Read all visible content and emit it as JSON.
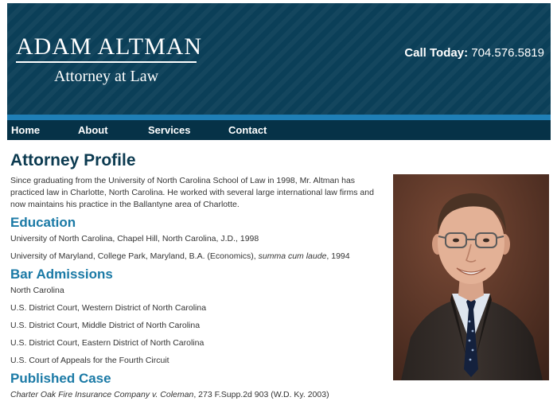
{
  "header": {
    "logo_name": "ADAM ALTMAN",
    "logo_sub": "Attorney at Law",
    "phone_label": "Call Today:",
    "phone_number": "704.576.5819"
  },
  "nav": {
    "items": [
      "Home",
      "About",
      "Services",
      "Contact"
    ]
  },
  "profile": {
    "title": "Attorney Profile",
    "intro": "Since graduating from the University of North Carolina School of Law in 1998, Mr. Altman has practiced law in Charlotte, North Carolina. He worked with several large international law firms and now maintains his practice in the Ballantyne area of Charlotte."
  },
  "education": {
    "heading": "Education",
    "item1": "University of North Carolina, Chapel Hill, North Carolina, J.D., 1998",
    "item2_text": "University of Maryland, College Park, Maryland, B.A. (Economics),",
    "item2_honor": "summa cum laude",
    "item2_year": ", 1994"
  },
  "bar": {
    "heading": "Bar Admissions",
    "items": [
      "North Carolina",
      "U.S. District Court, Western District of North Carolina",
      "U.S. District Court, Middle District of North Carolina",
      "U.S. District Court, Eastern District of North Carolina",
      "U.S. Court of Appeals for the Fourth Circuit"
    ]
  },
  "published": {
    "heading": "Published Case",
    "case_name": "Charter Oak Fire Insurance Company v. Coleman",
    "citation": ", 273 F.Supp.2d 903 (W.D. Ky. 2003)"
  },
  "colors": {
    "header_bg": "#0b3f58",
    "accent": "#1f7fb6",
    "nav_bg": "#063247",
    "heading": "#0b3a50",
    "subheading": "#1b7aa6"
  },
  "icons": {
    "photo": "attorney-portrait"
  }
}
